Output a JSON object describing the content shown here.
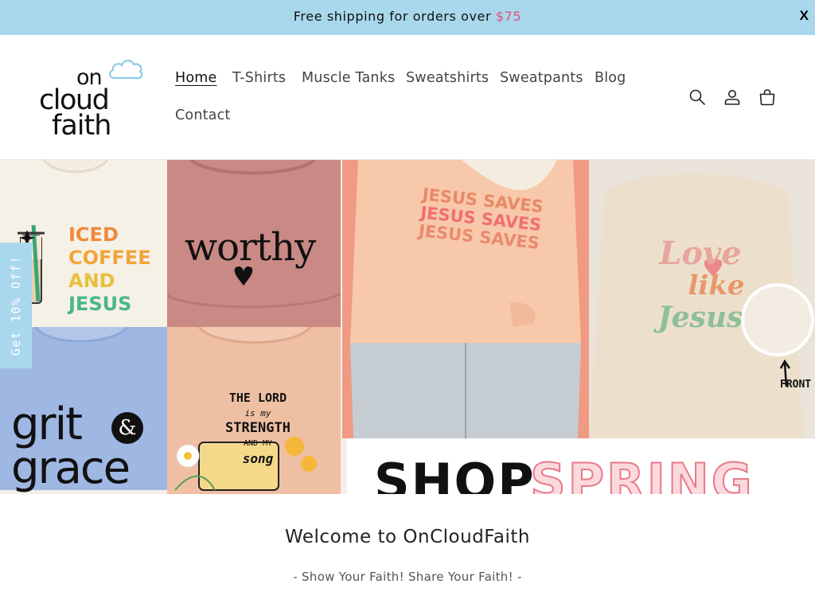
{
  "announcement": {
    "text": "Free shipping for orders over ",
    "price": "$75",
    "close_label": "X"
  },
  "logo": {
    "line1": "on",
    "line2": "cloud",
    "line3": "faith"
  },
  "nav": {
    "items": [
      {
        "label": "Home",
        "active": true
      },
      {
        "label": "T-Shirts"
      },
      {
        "label": "Muscle Tanks"
      },
      {
        "label": "Sweatshirts"
      },
      {
        "label": "Sweatpants"
      },
      {
        "label": "Blog"
      },
      {
        "label": "Contact"
      }
    ]
  },
  "header_icons": [
    "search-icon",
    "account-icon",
    "cart-icon"
  ],
  "hero": {
    "shirt_texts": {
      "iced": [
        "ICED",
        "COFFEE",
        "AND",
        "JESUS"
      ],
      "worthy": "worthy",
      "grit": [
        "grit",
        "&",
        "grace"
      ],
      "lord": [
        "THE LORD",
        "is my",
        "STRENGTH",
        "AND MY",
        "song"
      ],
      "saves": [
        "JESUS SAVES",
        "JESUS SAVES",
        "JESUS SAVES"
      ],
      "love": [
        "Love",
        "like",
        "Jesus"
      ],
      "front": "FRONT",
      "shop": "SHOP",
      "spring": "SPRING"
    }
  },
  "side_tab": {
    "label": "Get 10% Off!"
  },
  "welcome": {
    "title": "Welcome to OnCloudFaith",
    "tagline": "- Show Your Faith! Share Your Faith! -"
  },
  "colors": {
    "accent_blue": "#a9d7ec",
    "price_pink": "#e0507a"
  }
}
